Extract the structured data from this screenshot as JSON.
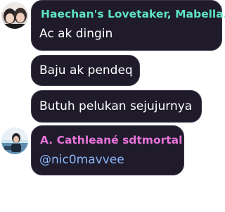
{
  "messages": [
    {
      "sender": "Haechan's Lovetaker, Mabella.",
      "sender_color": "#5fe3c4",
      "text": "Ac ak dingin",
      "avatar": "couple-selfie-avatar"
    },
    {
      "text": "Baju ak pendeq"
    },
    {
      "text": "Butuh pelukan sejujurnya"
    },
    {
      "sender": "A. Cathleané sdtmortal",
      "sender_color": "#e773d8",
      "text": "@nic0mavvee",
      "mention_color": "#8ab4f8",
      "avatar": "person-outdoor-avatar"
    }
  ]
}
